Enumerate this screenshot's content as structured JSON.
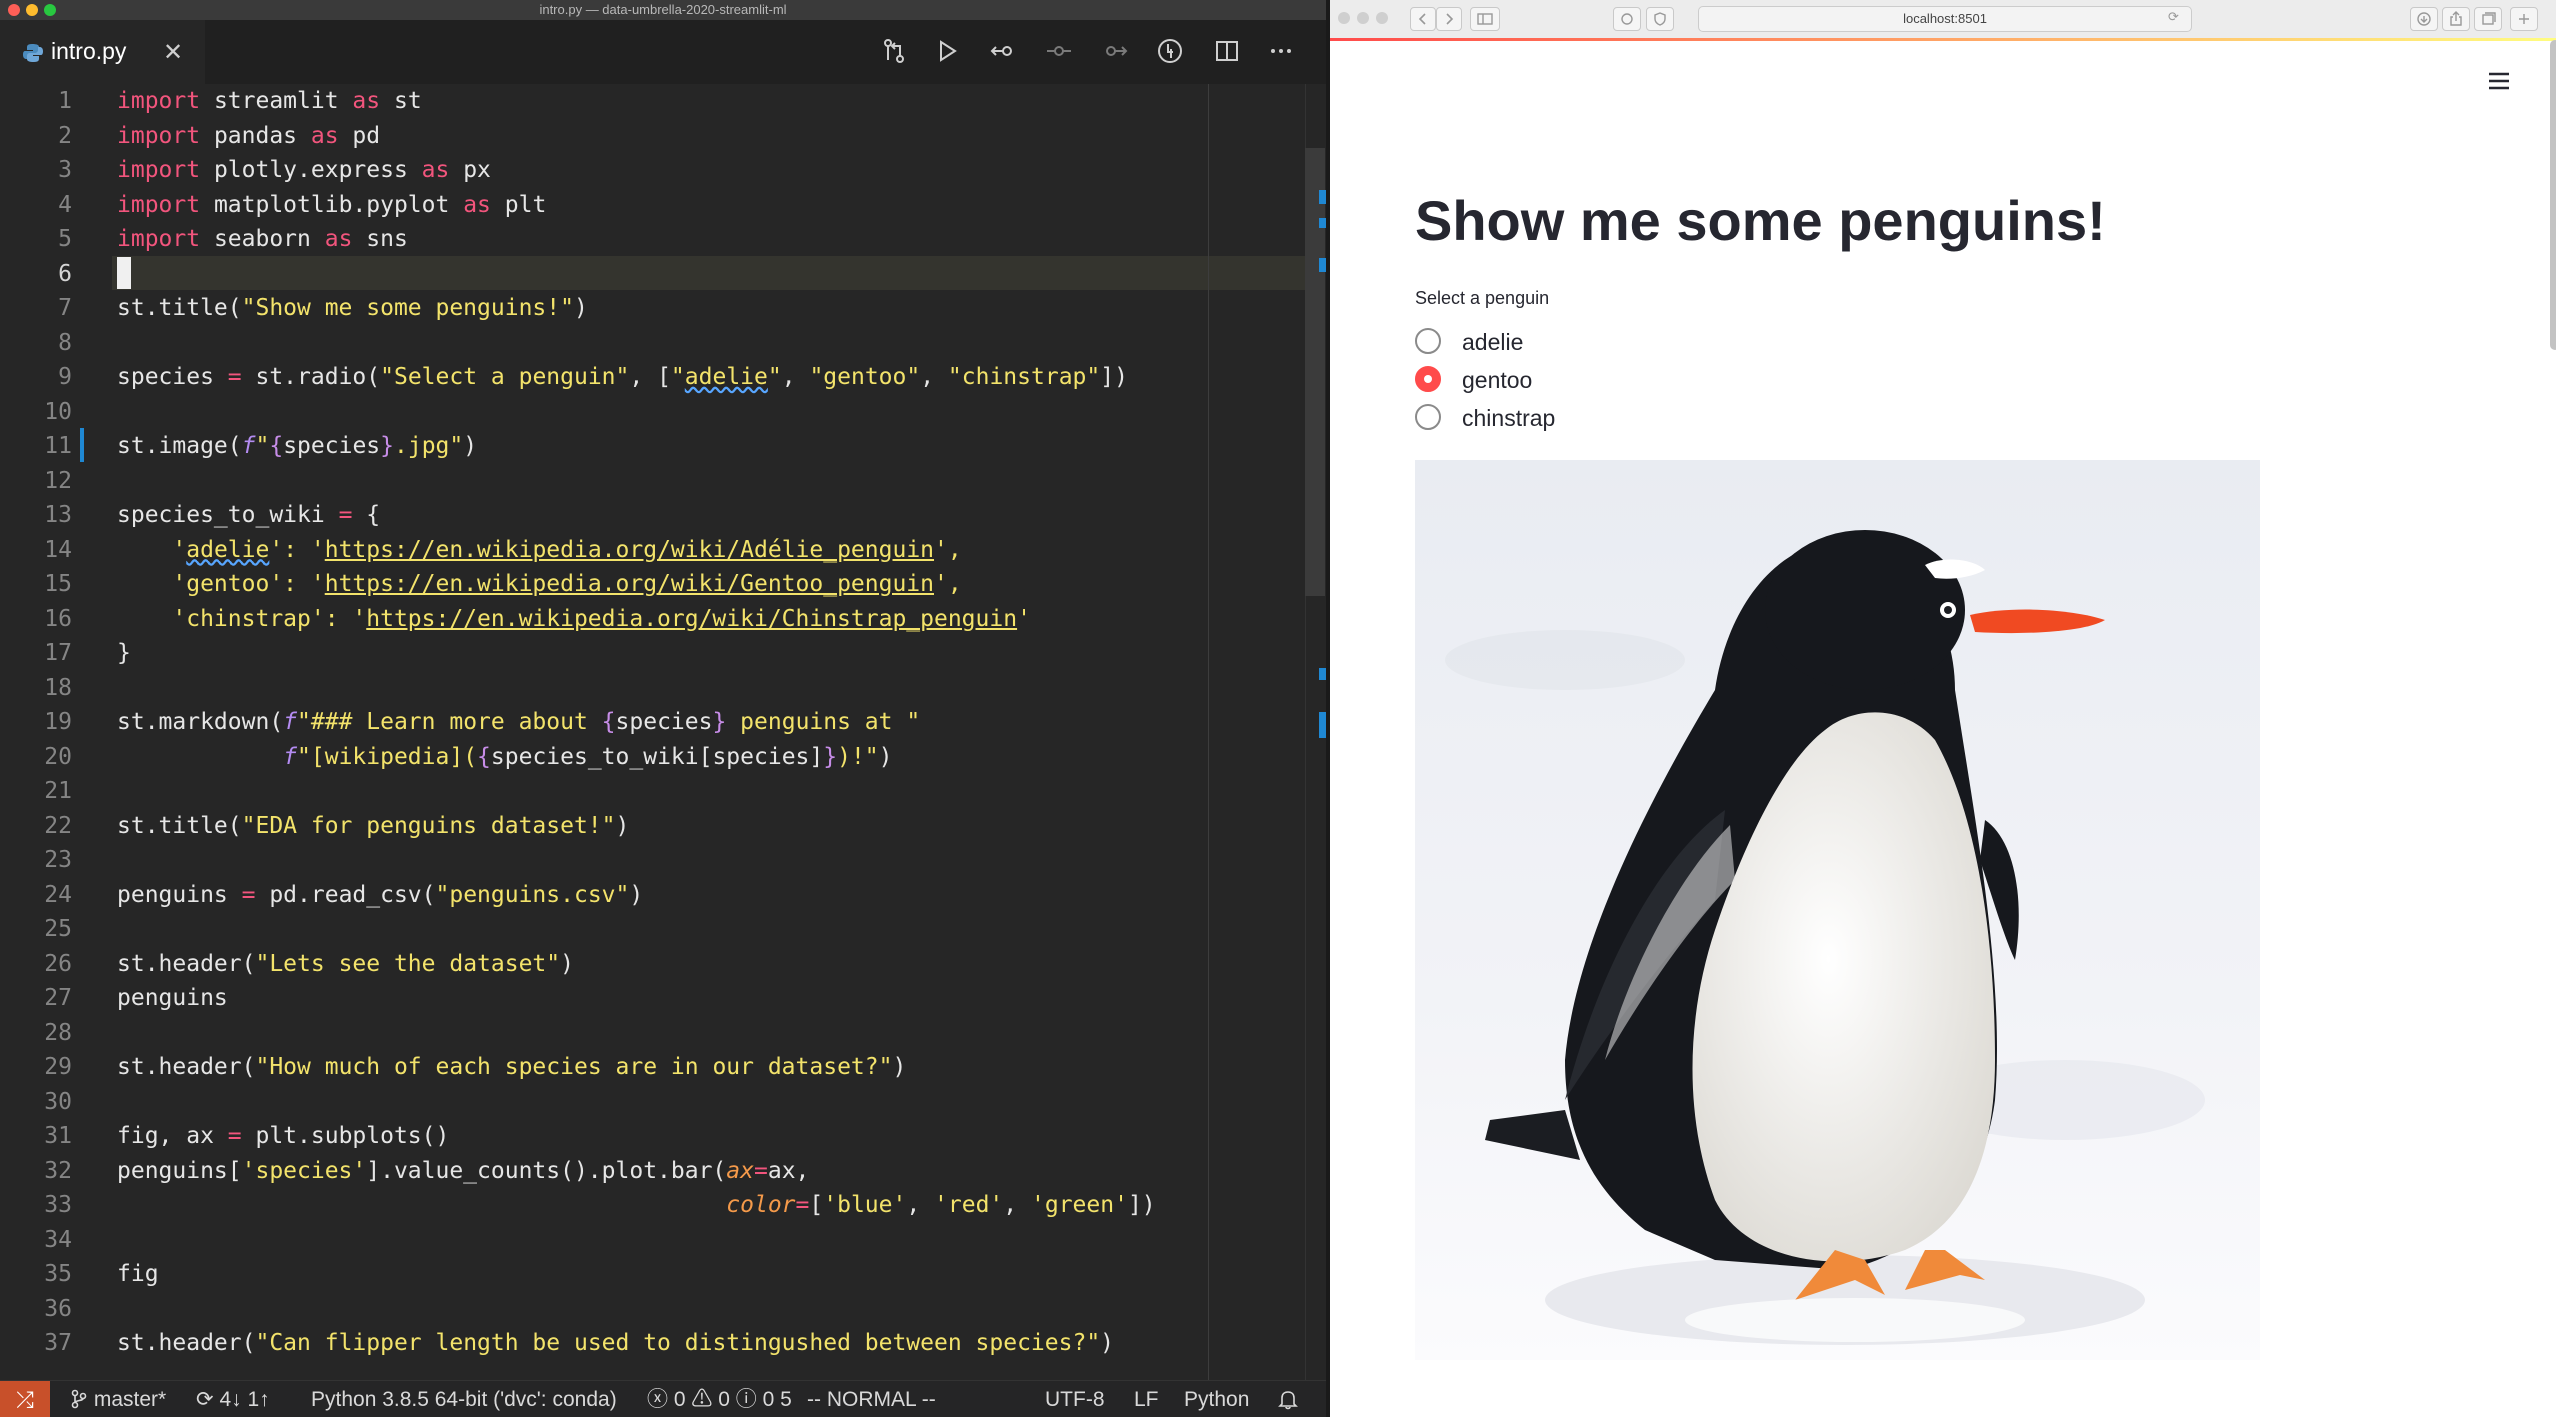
{
  "editor": {
    "window_title": "intro.py — data-umbrella-2020-streamlit-ml",
    "tab": {
      "filename": "intro.py",
      "close_glyph": "✕"
    },
    "toolbar_icons": [
      "open-changes-icon",
      "run-icon",
      "go-back-icon",
      "commit-icon",
      "go-forward-icon",
      "python-interpreter-icon",
      "split-editor-icon",
      "more-actions-icon"
    ],
    "current_line": 6,
    "line_numbers": [
      "1",
      "2",
      "3",
      "4",
      "5",
      "6",
      "7",
      "8",
      "9",
      "10",
      "11",
      "12",
      "13",
      "14",
      "15",
      "16",
      "17",
      "18",
      "19",
      "20",
      "21",
      "22",
      "23",
      "24",
      "25",
      "26",
      "27",
      "28",
      "29",
      "30",
      "31",
      "32",
      "33",
      "34",
      "35",
      "36",
      "37"
    ],
    "code": {
      "l1": [
        "import",
        " streamlit ",
        "as",
        " st"
      ],
      "l2": [
        "import",
        " pandas ",
        "as",
        " pd"
      ],
      "l3": [
        "import",
        " plotly.express ",
        "as",
        " px"
      ],
      "l4": [
        "import",
        " matplotlib.pyplot ",
        "as",
        " plt"
      ],
      "l5": [
        "import",
        " seaborn ",
        "as",
        " sns"
      ],
      "l7": [
        "st.title(",
        "\"Show me some penguins!\"",
        ")"
      ],
      "l9": [
        "species ",
        "=",
        " st.radio(",
        "\"Select a penguin\"",
        ", [",
        "\"",
        "adelie",
        "\"",
        ", ",
        "\"gentoo\"",
        ", ",
        "\"chinstrap\"",
        "])"
      ],
      "l11": [
        "st.image(",
        "f",
        "\"",
        "{",
        "species",
        "}",
        ".jpg\"",
        ")"
      ],
      "l13": [
        "species_to_wiki ",
        "=",
        " {"
      ],
      "l14": [
        "    '",
        "adelie",
        "': '",
        "https://en.wikipedia.org/wiki/Adélie_penguin",
        "',"
      ],
      "l15": [
        "    'gentoo': '",
        "https://en.wikipedia.org/wiki/Gentoo_penguin",
        "',"
      ],
      "l16": [
        "    'chinstrap': '",
        "https://en.wikipedia.org/wiki/Chinstrap_penguin",
        "'"
      ],
      "l17": [
        "}"
      ],
      "l19": [
        "st.markdown(",
        "f",
        "\"### Learn more about ",
        "{",
        "species",
        "}",
        " penguins at \""
      ],
      "l20": [
        "            ",
        "f",
        "\"[wikipedia](",
        "{",
        "species_to_wiki[species]",
        "}",
        ")!\"",
        ")"
      ],
      "l22": [
        "st.title(",
        "\"EDA for penguins dataset!\"",
        ")"
      ],
      "l24": [
        "penguins ",
        "=",
        " pd.read_csv(",
        "\"penguins.csv\"",
        ")"
      ],
      "l26": [
        "st.header(",
        "\"Lets see the dataset\"",
        ")"
      ],
      "l27": [
        "penguins"
      ],
      "l29": [
        "st.header(",
        "\"How much of each species are in our dataset?\"",
        ")"
      ],
      "l31": [
        "fig, ax ",
        "=",
        " plt.subplots()"
      ],
      "l32": [
        "penguins[",
        "'species'",
        "].value_counts().plot.bar(",
        "ax",
        "=",
        "ax,"
      ],
      "l33": [
        "                                            ",
        "color",
        "=",
        "[",
        "'blue'",
        ", ",
        "'red'",
        ", ",
        "'green'",
        "])"
      ],
      "l35": [
        "fig"
      ],
      "l37": [
        "st.header(",
        "\"Can flipper length be used to distingushed between species?\"",
        ")"
      ]
    },
    "statusbar": {
      "remote_glyph": "⤮",
      "branch": "master*",
      "sync": "4↓ 1↑",
      "interpreter": "Python 3.8.5 64-bit ('dvc': conda)",
      "problems": "0",
      "warnings": "0",
      "infos": "0",
      "info_extra": "5",
      "mode": "-- NORMAL --",
      "encoding": "UTF-8",
      "eol": "LF",
      "language": "Python",
      "bell_icon": "bell-icon"
    }
  },
  "browser": {
    "url": "localhost:8501",
    "app": {
      "title": "Show me some penguins!",
      "radio_label": "Select a penguin",
      "options": [
        "adelie",
        "gentoo",
        "chinstrap"
      ],
      "selected": "gentoo",
      "image_subject": "gentoo-penguin-photo"
    },
    "colors": {
      "accent": "#ff4b4b",
      "text": "#262730"
    }
  }
}
